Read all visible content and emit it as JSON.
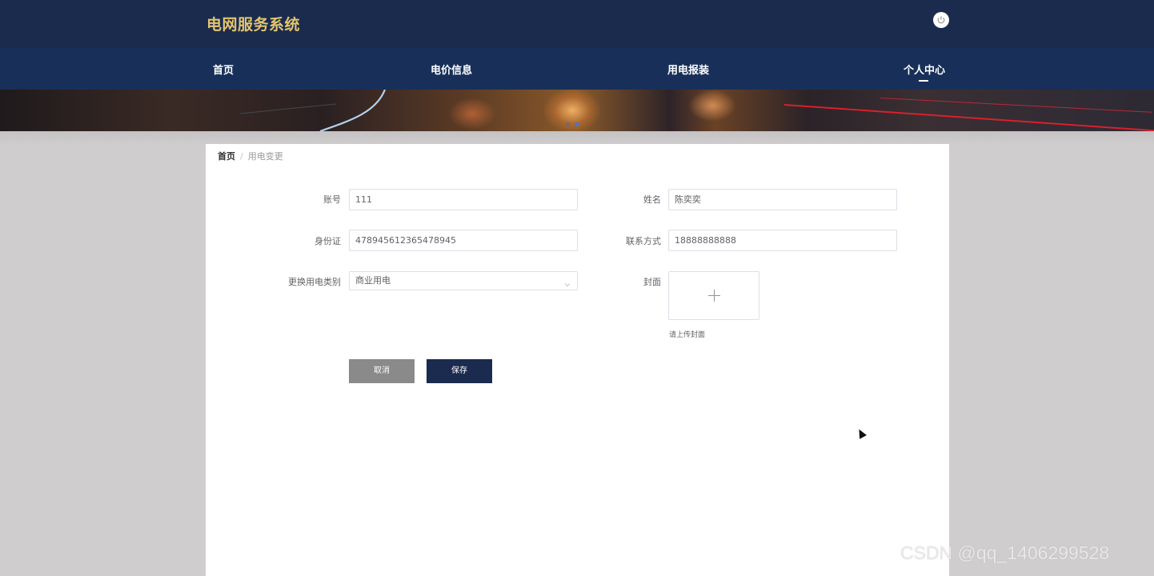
{
  "app": {
    "title": "电网服务系统"
  },
  "nav": {
    "items": [
      {
        "label": "首页"
      },
      {
        "label": "电价信息"
      },
      {
        "label": "用电报装"
      },
      {
        "label": "个人中心"
      }
    ],
    "active_index": 3
  },
  "banner": {
    "slide_count": 2,
    "active_slide": 2
  },
  "breadcrumb": {
    "home": "首页",
    "separator": "/",
    "current": "用电变更"
  },
  "form": {
    "account": {
      "label": "账号",
      "value": "111"
    },
    "name": {
      "label": "姓名",
      "value": "陈奕奕"
    },
    "id_card": {
      "label": "身份证",
      "value": "478945612365478945"
    },
    "phone": {
      "label": "联系方式",
      "value": "18888888888"
    },
    "category": {
      "label": "更换用电类别",
      "value": "商业用电"
    },
    "cover": {
      "label": "封面",
      "hint": "请上传封面"
    },
    "cancel_label": "取消",
    "save_label": "保存"
  },
  "watermark": "CSDN @qq_1406299528",
  "colors": {
    "header_bg": "#1a2b4d",
    "nav_bg": "#183059",
    "title_gold": "#e3c56f",
    "save_btn": "#1b2b4f",
    "cancel_btn": "#8a8a8a",
    "page_bg": "#cfcdcd"
  },
  "icons": {
    "power": "power-icon",
    "upload": "plus-icon",
    "select": "chevron-down-icon"
  }
}
